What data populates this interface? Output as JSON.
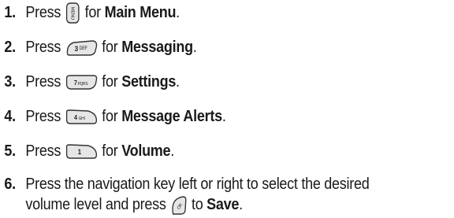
{
  "steps": [
    {
      "num": "1.",
      "pre": "Press",
      "key_label": "MENU",
      "mid": "for",
      "target": "Main Menu",
      "end": "."
    },
    {
      "num": "2.",
      "pre": "Press",
      "key_label": "3 DEF",
      "mid": "for",
      "target": "Messaging",
      "end": "."
    },
    {
      "num": "3.",
      "pre": "Press",
      "key_label": "7 PQRS",
      "mid": "for",
      "target": "Settings",
      "end": "."
    },
    {
      "num": "4.",
      "pre": "Press",
      "key_label": "4 GHI",
      "mid": "for",
      "target": "Message Alerts",
      "end": "."
    },
    {
      "num": "5.",
      "pre": "Press",
      "key_label": "1",
      "mid": "for",
      "target": "Volume",
      "end": "."
    },
    {
      "num": "6.",
      "line1": "Press the navigation key left or right to select the desired",
      "line2_pre": "volume level and press",
      "key_label": "OK",
      "mid": "to",
      "target": "Save",
      "end": "."
    }
  ],
  "icons": {
    "menu_key": "menu-key-icon",
    "key_3": "key-3-def-icon",
    "key_7": "key-7-pqrs-icon",
    "key_4": "key-4-ghi-icon",
    "key_1": "key-1-icon",
    "ok_key": "ok-key-icon"
  },
  "colors": {
    "text": "#1a1a1a",
    "key_fill": "#e6e6e6",
    "key_stroke": "#333333"
  }
}
